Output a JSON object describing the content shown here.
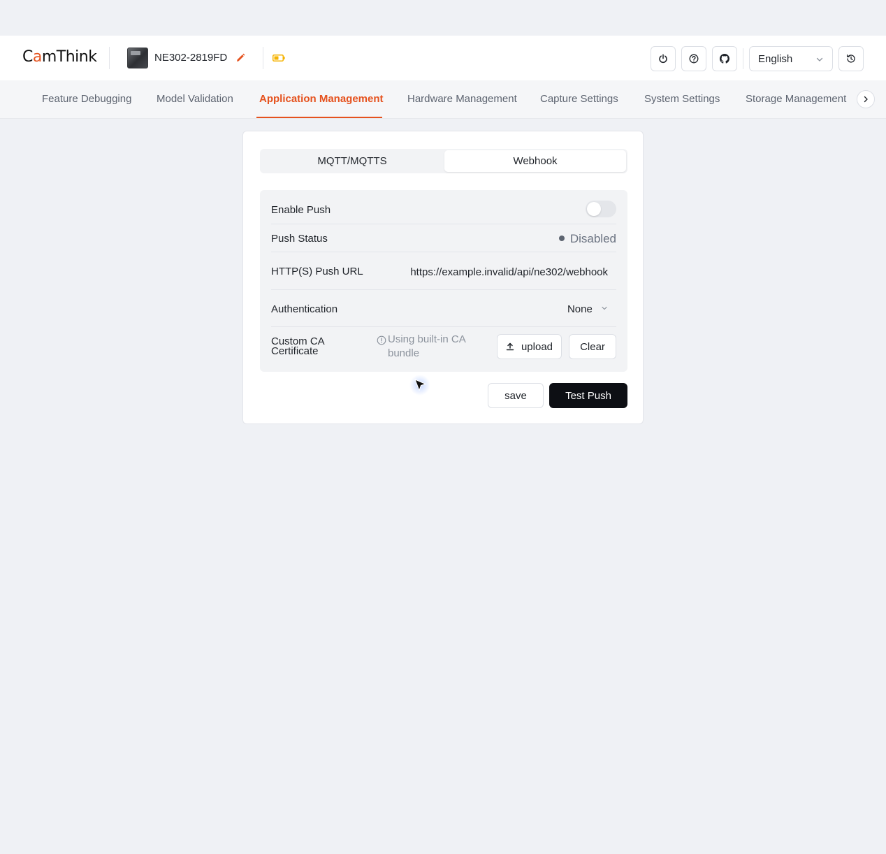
{
  "brand": {
    "logo_text_1": "C",
    "logo_accent": "a",
    "logo_text_2": "mThink"
  },
  "device": {
    "name": "NE302-2819FD"
  },
  "header": {
    "power_icon": "power-icon",
    "help_icon": "help-icon",
    "github_icon": "github-icon",
    "history_icon": "history-icon",
    "language": "English"
  },
  "tabs": [
    {
      "label": "Feature Debugging"
    },
    {
      "label": "Model Validation"
    },
    {
      "label": "Application Management"
    },
    {
      "label": "Hardware Management"
    },
    {
      "label": "Capture Settings"
    },
    {
      "label": "System Settings"
    },
    {
      "label": "Storage Management"
    }
  ],
  "active_tab": "Application Management",
  "segments": [
    {
      "label": "MQTT/MQTTS"
    },
    {
      "label": "Webhook"
    }
  ],
  "active_segment": "Webhook",
  "form": {
    "enable_push": {
      "label": "Enable Push",
      "enabled": false
    },
    "push_status": {
      "label": "Push Status",
      "value": "Disabled"
    },
    "push_url": {
      "label": "HTTP(S) Push URL",
      "value": "https://example.invalid/api/ne302/webhook"
    },
    "authentication": {
      "label": "Authentication",
      "value": "None"
    },
    "ca_cert": {
      "label_1": "Custom CA",
      "label_2": "Certificate",
      "hint_1": "Using built-in CA",
      "hint_2": "bundle",
      "upload_label": "upload",
      "clear_label": "Clear"
    }
  },
  "actions": {
    "save_label": "save",
    "test_label": "Test Push"
  },
  "colors": {
    "accent": "#e5521e",
    "primary_button": "#0d0f14",
    "background": "#eff1f5",
    "battery": "#f5b301"
  }
}
